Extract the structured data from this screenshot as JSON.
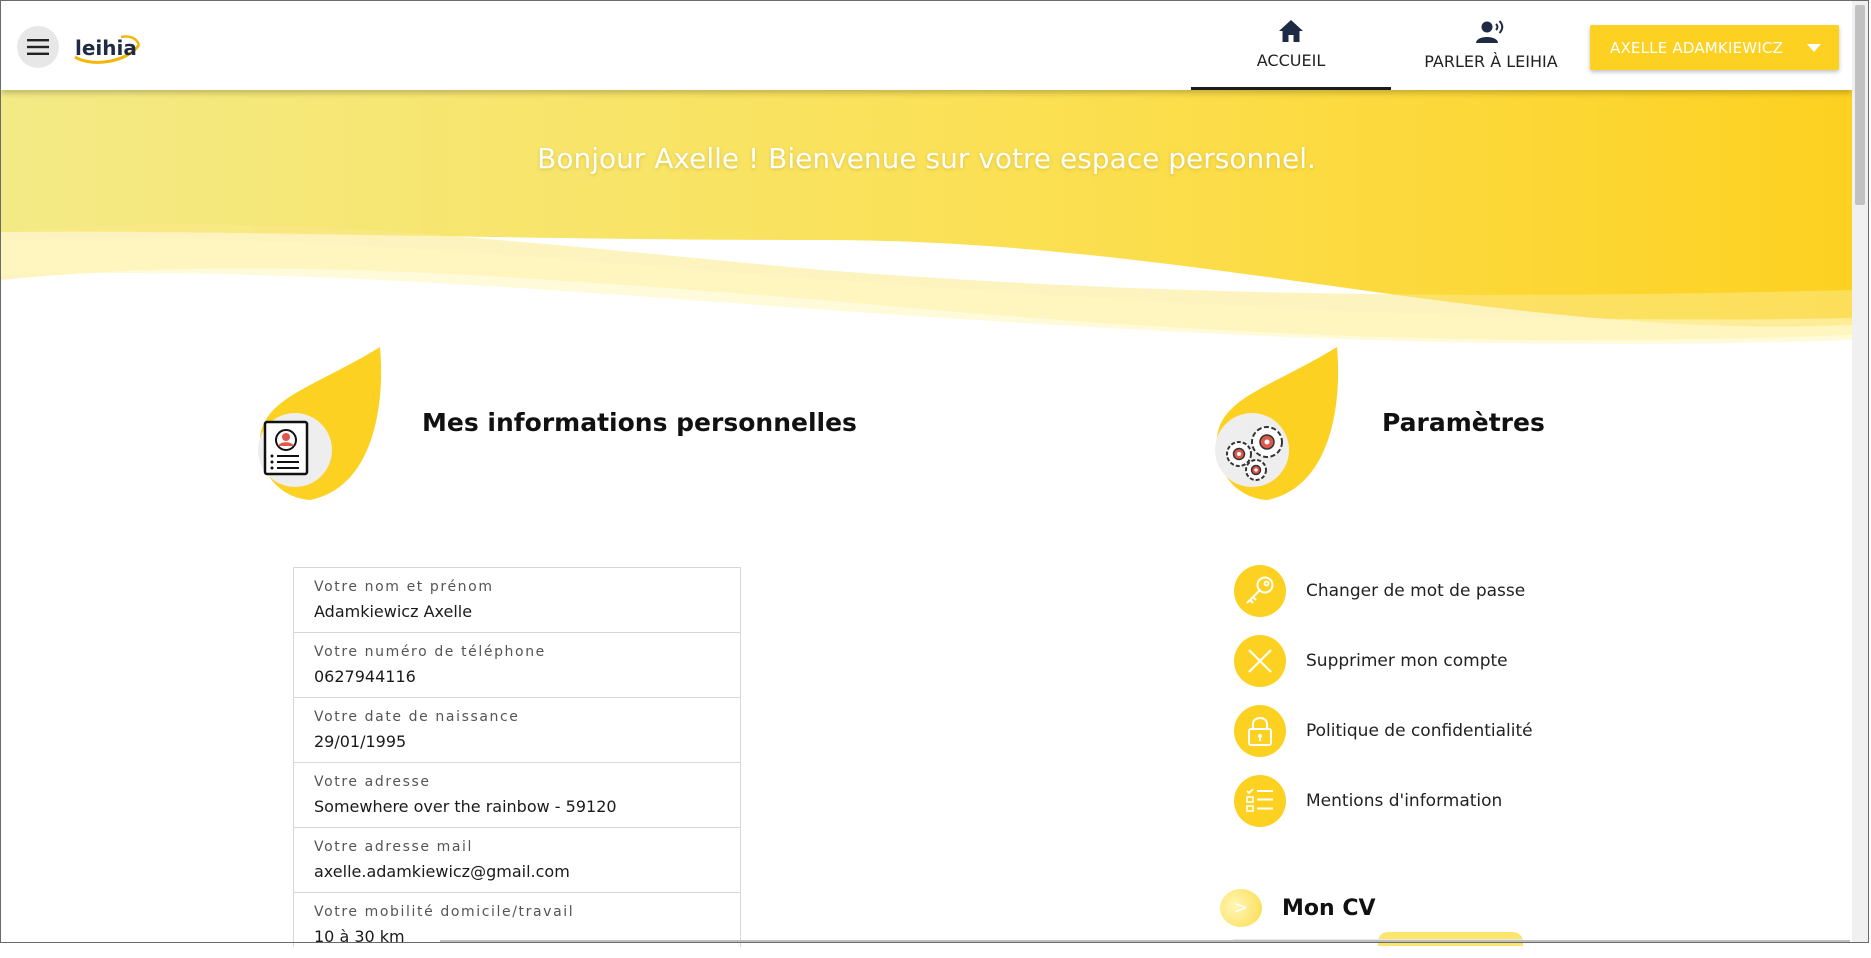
{
  "header": {
    "menu_icon": "hamburger-menu-icon",
    "logo_text": "leihia",
    "tabs": [
      {
        "label": "ACCUEIL",
        "icon": "home-icon",
        "active": true
      },
      {
        "label": "PARLER À LEIHIA",
        "icon": "voice-user-icon",
        "active": false
      }
    ],
    "user_menu": {
      "label": "AXELLE ADAMKIEWICZ",
      "icon": "caret-down-icon"
    }
  },
  "banner": {
    "greeting": "Bonjour Axelle ! Bienvenue sur votre espace personnel."
  },
  "personal_info": {
    "title": "Mes informations personnelles",
    "icon": "profile-card-icon",
    "fields": [
      {
        "label": "Votre nom et prénom",
        "value": "Adamkiewicz Axelle"
      },
      {
        "label": "Votre numéro de téléphone",
        "value": "0627944116"
      },
      {
        "label": "Votre date de naissance",
        "value": "29/01/1995"
      },
      {
        "label": "Votre adresse",
        "value": "Somewhere over the rainbow - 59120"
      },
      {
        "label": "Votre adresse mail",
        "value": "axelle.adamkiewicz@gmail.com"
      },
      {
        "label": "Votre mobilité domicile/travail",
        "value": "10 à 30 km"
      }
    ]
  },
  "settings": {
    "title": "Paramètres",
    "icon": "gears-icon",
    "items": [
      {
        "label": "Changer de mot de passe",
        "icon": "key-icon"
      },
      {
        "label": "Supprimer mon compte",
        "icon": "close-icon"
      },
      {
        "label": "Politique de confidentialité",
        "icon": "lock-icon"
      },
      {
        "label": "Mentions d'information",
        "icon": "checklist-icon"
      }
    ]
  },
  "cv": {
    "title": "Mon CV",
    "bullet": ">"
  },
  "colors": {
    "accent": "#fdd121",
    "banner_light": "#f3ea86",
    "text": "#1e1e1e"
  }
}
